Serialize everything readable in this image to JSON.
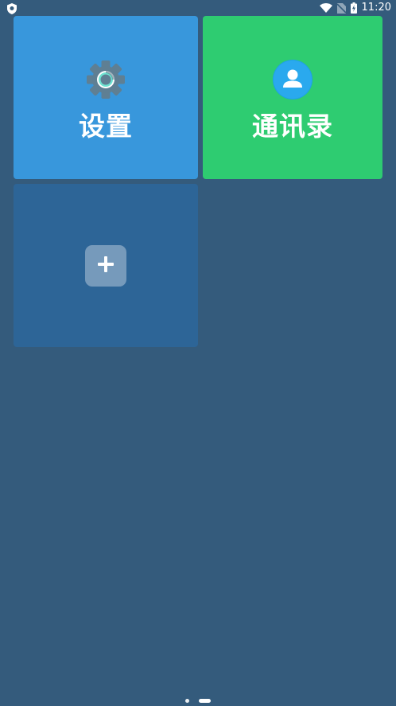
{
  "status_bar": {
    "time": "11:20",
    "icons": [
      "shield-icon",
      "wifi-icon",
      "no-sim-icon",
      "battery-charging-icon"
    ]
  },
  "tiles": [
    {
      "label": "设置",
      "icon": "gear-icon",
      "color": "#3897dc"
    },
    {
      "label": "通讯录",
      "icon": "contact-icon",
      "color": "#2ecc71"
    },
    {
      "label": "",
      "icon": "plus-icon",
      "color": "#2d6597"
    }
  ],
  "pager": {
    "pages": 2,
    "current": 2
  },
  "colors": {
    "background": "#345b7c"
  }
}
